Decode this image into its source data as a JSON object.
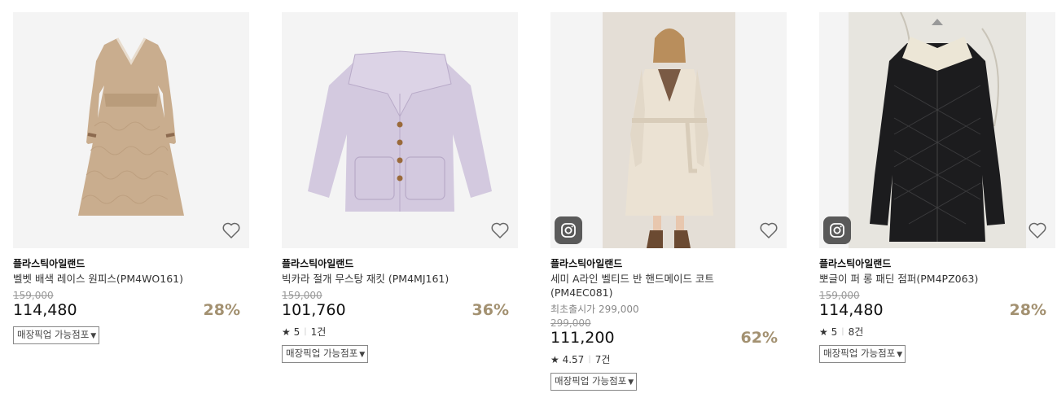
{
  "products": [
    {
      "brand": "플라스틱아일랜드",
      "name": "벨벳 배색 레이스 원피스(PM4WO161)",
      "original_price": "159,000",
      "price": "114,480",
      "discount": "28%",
      "pickup_label": "매장픽업 가능점포",
      "image_icon": "dress-beige-lace"
    },
    {
      "brand": "플라스틱아일랜드",
      "name": "빅카라 절개 무스탕 재킷 (PM4MJ161)",
      "original_price": "159,000",
      "price": "101,760",
      "discount": "36%",
      "rating": "5",
      "review_count": "1건",
      "pickup_label": "매장픽업 가능점포",
      "image_icon": "jacket-lavender"
    },
    {
      "brand": "플라스틱아일랜드",
      "name": "세미 A라인 벨티드 반 핸드메이드 코트 (PM4EC081)",
      "launch_price": "최초출시가 299,000",
      "original_price": "299,000",
      "price": "111,200",
      "discount": "62%",
      "rating": "4.57",
      "review_count": "7건",
      "pickup_label": "매장픽업 가능점포",
      "image_icon": "coat-cream-model"
    },
    {
      "brand": "플라스틱아일랜드",
      "name": "뽀글이 퍼 롱 패딘 점퍼(PM4PZ063)",
      "original_price": "159,000",
      "price": "114,480",
      "discount": "28%",
      "rating": "5",
      "review_count": "8건",
      "pickup_label": "매장픽업 가능점포",
      "image_icon": "padded-jumper-black"
    }
  ],
  "icons": {
    "wishlist": "heart-outline-icon",
    "instagram": "instagram-icon",
    "star": "star-icon",
    "dropdown": "triangle-down-icon"
  },
  "colors": {
    "discount": "#a39171",
    "thumb_bg": "#f3f3f3",
    "insta_badge": "#5a5a5a"
  }
}
